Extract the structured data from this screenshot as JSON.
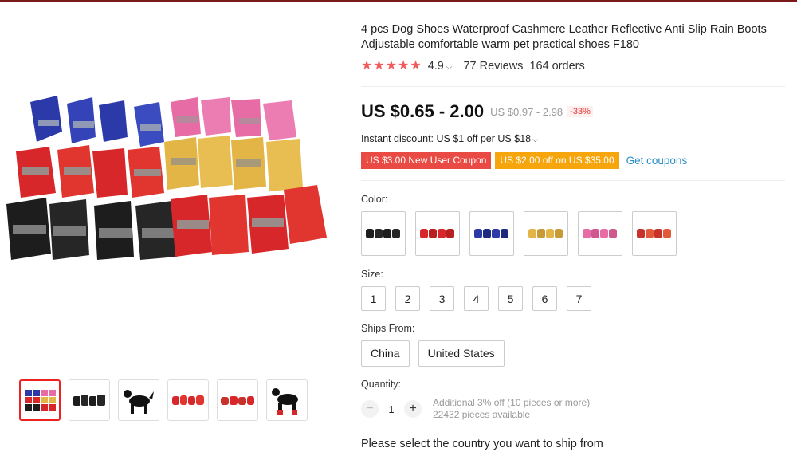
{
  "product": {
    "title": "4 pcs Dog Shoes Waterproof Cashmere Leather Reflective Anti Slip Rain Boots Adjustable comfortable warm pet practical shoes F180",
    "rating": "4.9",
    "rating_stars": 5,
    "reviews": "77 Reviews",
    "orders": "164 orders"
  },
  "price": {
    "current": "US $0.65 - 2.00",
    "original": "US $0.97 - 2.98",
    "discount": "-33%",
    "instant_discount": "Instant discount: US $1 off per US $18"
  },
  "coupons": {
    "new_user": "US $3.00 New User Coupon",
    "spend_off": "US $2.00 off on US $35.00",
    "get_link": "Get coupons"
  },
  "colors": {
    "brand_red": "#ea4a44",
    "brand_orange": "#f6a50c",
    "link_blue": "#2a8ec8",
    "star": "#f25b5b"
  },
  "options": {
    "color_label": "Color:",
    "color_swatches": [
      {
        "name": "black",
        "hex": "#1d1d1d"
      },
      {
        "name": "red",
        "hex": "#d8272b"
      },
      {
        "name": "blue",
        "hex": "#2b3aa8"
      },
      {
        "name": "yellow",
        "hex": "#e3b546"
      },
      {
        "name": "pink",
        "hex": "#e76ca6"
      },
      {
        "name": "red-dark",
        "hex": "#c8322a"
      }
    ],
    "size_label": "Size:",
    "sizes": [
      "1",
      "2",
      "3",
      "4",
      "5",
      "6",
      "7"
    ],
    "ships_label": "Ships From:",
    "ships_from": [
      "China",
      "United States"
    ]
  },
  "quantity": {
    "label": "Quantity:",
    "value": "1",
    "note_discount": "Additional 3% off (10 pieces or more)",
    "note_available": "22432 pieces available"
  },
  "shipping_message": "Please select the country you want to ship from",
  "gallery": {
    "thumbnails": [
      {
        "name": "all-colors",
        "active": true
      },
      {
        "name": "black-shoes",
        "active": false
      },
      {
        "name": "dog-black",
        "active": false
      },
      {
        "name": "red-shoes",
        "active": false
      },
      {
        "name": "red-shoes-2",
        "active": false
      },
      {
        "name": "dog-red",
        "active": false
      }
    ]
  }
}
